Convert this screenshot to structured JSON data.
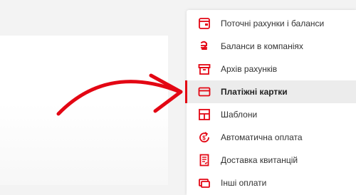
{
  "colors": {
    "accent": "#e30613",
    "page_background": "#f3f3f3",
    "active_item_background": "#ececec"
  },
  "menu": {
    "items": [
      {
        "label": "Поточні рахунки і баланси",
        "icon": "wallet-icon",
        "active": false
      },
      {
        "label": "Баланси в компаніях",
        "icon": "hryvnia-icon",
        "active": false
      },
      {
        "label": "Архів рахунків",
        "icon": "archive-box-icon",
        "active": false
      },
      {
        "label": "Платіжні картки",
        "icon": "credit-card-icon",
        "active": true
      },
      {
        "label": "Шаблони",
        "icon": "template-layout-icon",
        "active": false
      },
      {
        "label": "Автоматична оплата",
        "icon": "auto-payment-icon",
        "active": false
      },
      {
        "label": "Доставка квитанцій",
        "icon": "receipt-icon",
        "active": false
      },
      {
        "label": "Інші оплати",
        "icon": "other-payments-icon",
        "active": false
      }
    ]
  }
}
